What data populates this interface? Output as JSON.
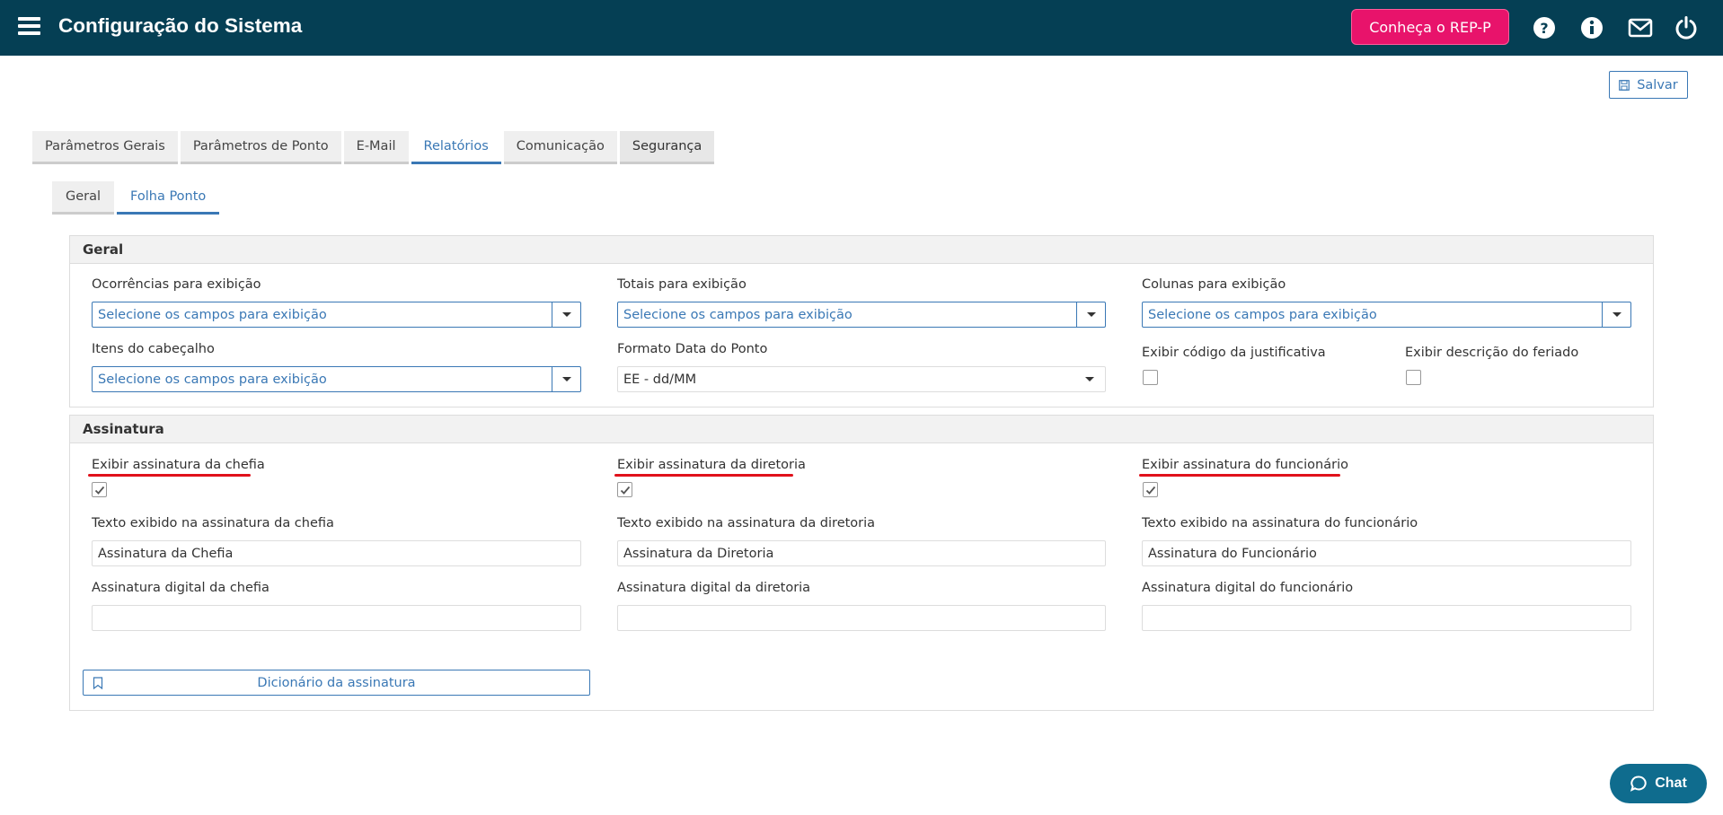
{
  "header": {
    "title": "Configuração do Sistema",
    "rep_button": "Conheça o REP-P",
    "icons": [
      "menu-icon",
      "help-icon",
      "info-icon",
      "mail-icon",
      "power-icon"
    ]
  },
  "toolbar": {
    "save_label": "Salvar"
  },
  "tabs": [
    {
      "label": "Parâmetros Gerais"
    },
    {
      "label": "Parâmetros de Ponto"
    },
    {
      "label": "E-Mail"
    },
    {
      "label": "Relatórios"
    },
    {
      "label": "Comunicação"
    },
    {
      "label": "Segurança"
    }
  ],
  "active_tab": "Relatórios",
  "subtabs": [
    {
      "label": "Geral"
    },
    {
      "label": "Folha Ponto"
    }
  ],
  "active_subtab": "Folha Ponto",
  "geral": {
    "title": "Geral",
    "ocorrencias": {
      "label": "Ocorrências para exibição",
      "placeholder": "Selecione os campos para exibição"
    },
    "totais": {
      "label": "Totais para exibição",
      "placeholder": "Selecione os campos para exibição"
    },
    "colunas": {
      "label": "Colunas para exibição",
      "placeholder": "Selecione os campos para exibição"
    },
    "itens_cabecalho": {
      "label": "Itens do cabeçalho",
      "placeholder": "Selecione os campos para exibição"
    },
    "formato_data": {
      "label": "Formato Data do Ponto",
      "value": "EE - dd/MM"
    },
    "exibir_codigo": {
      "label": "Exibir código da justificativa",
      "checked": false
    },
    "exibir_feriado": {
      "label": "Exibir descrição do feriado",
      "checked": false
    }
  },
  "assinatura": {
    "title": "Assinatura",
    "chefia": {
      "show_label": "Exibir assinatura da chefia",
      "checked": true,
      "text_label": "Texto exibido na assinatura da chefia",
      "text_value": "Assinatura da Chefia",
      "digital_label": "Assinatura digital da chefia",
      "digital_value": ""
    },
    "diretoria": {
      "show_label": "Exibir assinatura da diretoria",
      "checked": true,
      "text_label": "Texto exibido na assinatura da diretoria",
      "text_value": "Assinatura da Diretoria",
      "digital_label": "Assinatura digital da diretoria",
      "digital_value": ""
    },
    "funcionario": {
      "show_label": "Exibir assinatura do funcionário",
      "checked": true,
      "text_label": "Texto exibido na assinatura do funcionário",
      "text_value": "Assinatura do Funcionário",
      "digital_label": "Assinatura digital do funcionário",
      "digital_value": ""
    },
    "dictionary_button": "Dicionário da assinatura"
  },
  "chat": {
    "label": "Chat"
  },
  "colors": {
    "header_bg": "#053f54",
    "accent": "#3a78b5",
    "rep_button": "#e8136b",
    "annotation_underline": "#e0111b",
    "chat_bg": "#0f6c8e"
  }
}
